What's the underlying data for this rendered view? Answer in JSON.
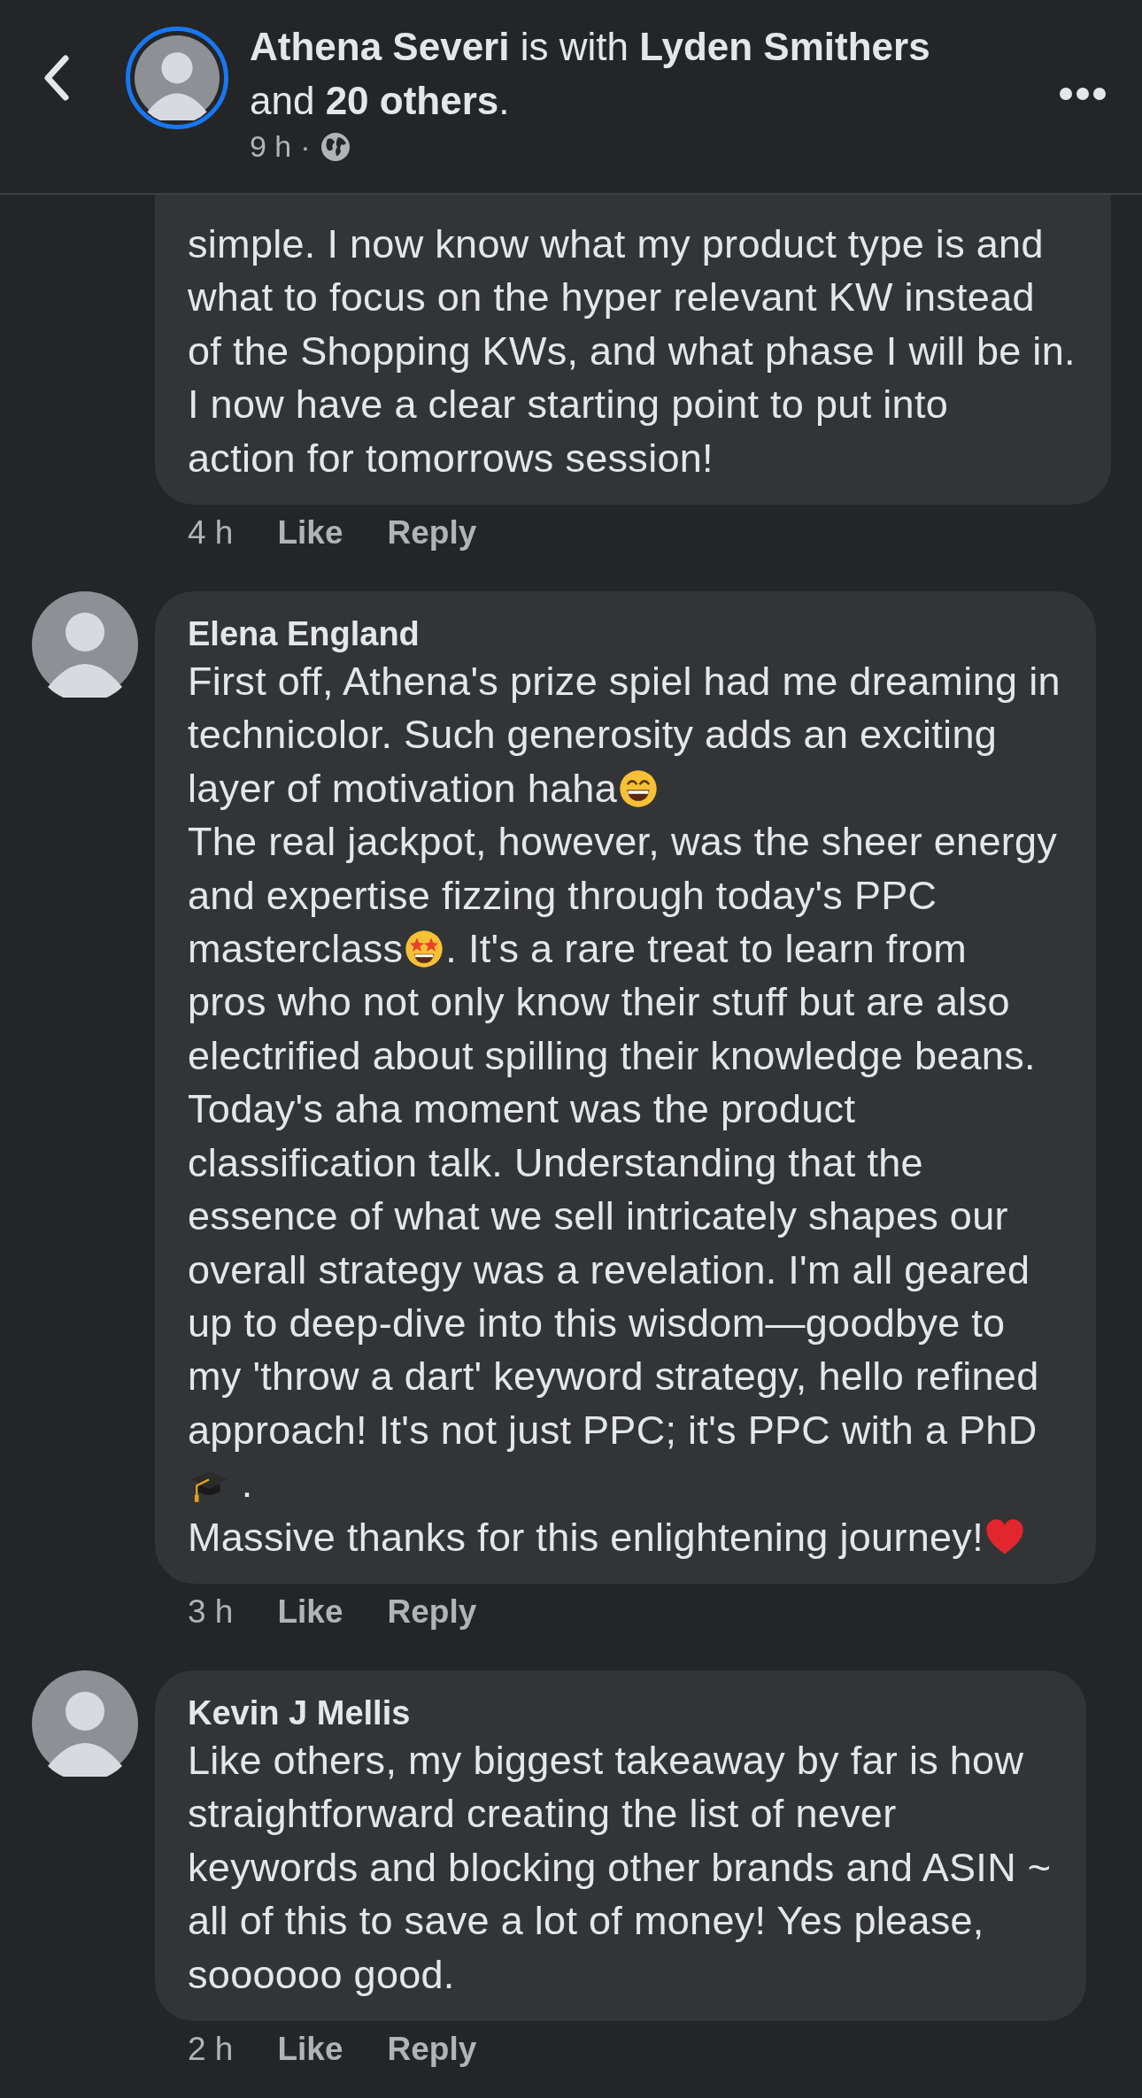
{
  "header": {
    "title": "**Athena Severi** is with **Lyden Smithers** and **20 others**.",
    "time": "9 h",
    "separator": "·"
  },
  "comments": [
    {
      "lines": [
        [
          "simple. I now know what my product type is and"
        ],
        [
          "what to focus on the hyper relevant KW instead"
        ],
        [
          "of the Shopping KWs, and what phase I will be in."
        ],
        [
          "I now have a clear starting point to put into"
        ],
        [
          "action for tomorrows session!"
        ]
      ],
      "time": "4 h",
      "actions": [
        "Like",
        "Reply"
      ]
    },
    {
      "author": "Elena England",
      "lines": [
        [
          "First off, Athena's prize spiel had me dreaming in"
        ],
        [
          "technicolor. Such generosity adds an exciting"
        ],
        [
          "layer of motivation haha",
          {
            "kind": "grin"
          }
        ],
        [
          "The real jackpot, however, was the sheer energy"
        ],
        [
          "and expertise fizzing through today's PPC"
        ],
        [
          "masterclass",
          {
            "kind": "star_struck"
          },
          ". It's a rare treat to learn from"
        ],
        [
          "pros who not only know their stuff but are also"
        ],
        [
          "electrified about spilling their knowledge beans."
        ],
        [
          "Today's aha moment was the product"
        ],
        [
          "classification talk. Understanding that the"
        ],
        [
          "essence of what we sell intricately shapes our"
        ],
        [
          "overall strategy was a revelation. I'm all geared"
        ],
        [
          "up to deep-dive into this wisdom—goodbye to"
        ],
        [
          "my 'throw a dart' keyword strategy, hello refined"
        ],
        [
          "approach! It's not just PPC; it's PPC with a PhD"
        ],
        [
          {
            "kind": "grad_cap"
          },
          " ."
        ],
        [
          "Massive thanks for this enlightening journey!",
          {
            "kind": "heart"
          }
        ]
      ],
      "time": "3 h",
      "actions": [
        "Like",
        "Reply"
      ]
    },
    {
      "author": "Kevin J Mellis",
      "lines": [
        [
          "Like others, my biggest takeaway by far is how"
        ],
        [
          "straightforward creating the list of never"
        ],
        [
          "keywords and blocking other brands and ASIN ~"
        ],
        [
          "all of this to save a lot of money! Yes please,"
        ],
        [
          "soooooo good."
        ]
      ],
      "time": "2 h",
      "actions": [
        "Like",
        "Reply"
      ]
    }
  ]
}
